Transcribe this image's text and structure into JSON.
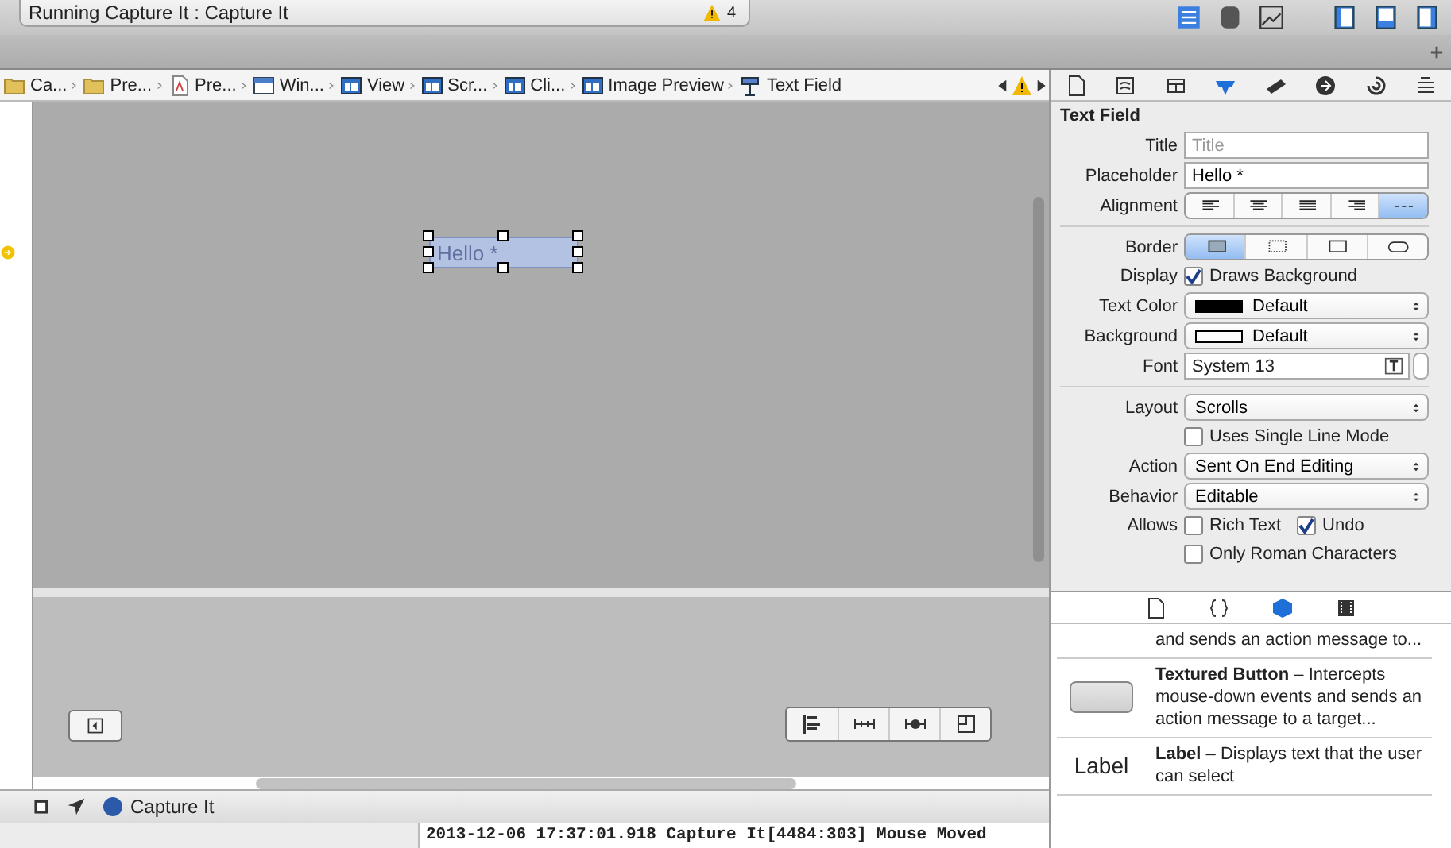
{
  "toolbar": {
    "status": "Running Capture It : Capture It",
    "warning_count": "4"
  },
  "breadcrumbs": [
    {
      "label": "Ca...",
      "kind": "folder"
    },
    {
      "label": "Pre...",
      "kind": "folder"
    },
    {
      "label": "Pre...",
      "kind": "file"
    },
    {
      "label": "Win...",
      "kind": "window"
    },
    {
      "label": "View",
      "kind": "view"
    },
    {
      "label": "Scr...",
      "kind": "view"
    },
    {
      "label": "Cli...",
      "kind": "view"
    },
    {
      "label": "Image Preview",
      "kind": "view"
    },
    {
      "label": "Text Field",
      "kind": "field"
    }
  ],
  "canvas": {
    "text_field": {
      "placeholder": "Hello *"
    }
  },
  "inspector": {
    "tabs": [
      {
        "selected": false
      },
      {
        "selected": false
      },
      {
        "selected": false
      },
      {
        "selected": true
      },
      {
        "selected": false
      },
      {
        "selected": false
      },
      {
        "selected": false
      },
      {
        "selected": false
      }
    ],
    "section_title": "Text Field",
    "rows": [
      {
        "kind": "text",
        "label": "Title",
        "placeholder": "Title"
      },
      {
        "kind": "text",
        "label": "Placeholder",
        "value": "Hello *"
      },
      {
        "kind": "segmented",
        "label": "Alignment",
        "segments": [
          {
            "kind": "left",
            "selected": false
          },
          {
            "kind": "center",
            "selected": false
          },
          {
            "kind": "justify",
            "selected": false
          },
          {
            "kind": "right",
            "selected": false
          },
          {
            "kind": "natural",
            "selected": true
          }
        ]
      },
      {
        "kind": "separator"
      },
      {
        "kind": "segmented",
        "label": "Border",
        "segments": [
          {
            "kind": "bezel",
            "selected": true
          },
          {
            "kind": "dotted",
            "selected": false
          },
          {
            "kind": "square",
            "selected": false
          },
          {
            "kind": "rounded",
            "selected": false
          }
        ]
      },
      {
        "kind": "checks",
        "label": "Display",
        "options": [
          {
            "label": "Draws Background",
            "checked": true
          }
        ]
      },
      {
        "kind": "popup",
        "label": "Text Color",
        "value": "Default",
        "color": "#000000"
      },
      {
        "kind": "popup",
        "label": "Background",
        "value": "Default",
        "color": "#ffffff"
      },
      {
        "kind": "font",
        "label": "Font",
        "value": "System 13"
      },
      {
        "kind": "separator"
      },
      {
        "kind": "popup",
        "label": "Layout",
        "value": "Scrolls"
      },
      {
        "kind": "checks",
        "options": [
          {
            "label": "Uses Single Line Mode",
            "checked": false
          }
        ]
      },
      {
        "kind": "popup",
        "label": "Action",
        "value": "Sent On End Editing"
      },
      {
        "kind": "popup",
        "label": "Behavior",
        "value": "Editable"
      },
      {
        "kind": "checks",
        "label": "Allows",
        "options": [
          {
            "label": "Rich Text",
            "checked": false
          },
          {
            "label": "Undo",
            "checked": true
          }
        ]
      },
      {
        "kind": "checks",
        "options": [
          {
            "label": "Only Roman Characters",
            "checked": false
          }
        ]
      }
    ]
  },
  "library": {
    "tabs": [
      {
        "selected": false
      },
      {
        "selected": false
      },
      {
        "selected": true
      },
      {
        "selected": false
      }
    ],
    "items": [
      {
        "kind": "text",
        "text": "and sends an action message to..."
      },
      {
        "kind": "button",
        "text": "**Textured Button** – Intercepts mouse-down events and sends an action message to a target..."
      },
      {
        "kind": "label",
        "preview": "Label",
        "text": "**Label** – Displays text that the user can select"
      }
    ]
  },
  "debug_bar": {
    "target": "Capture It"
  },
  "console": {
    "line": "2013-12-06 17:37:01.918 Capture It[4484:303] Mouse Moved"
  }
}
